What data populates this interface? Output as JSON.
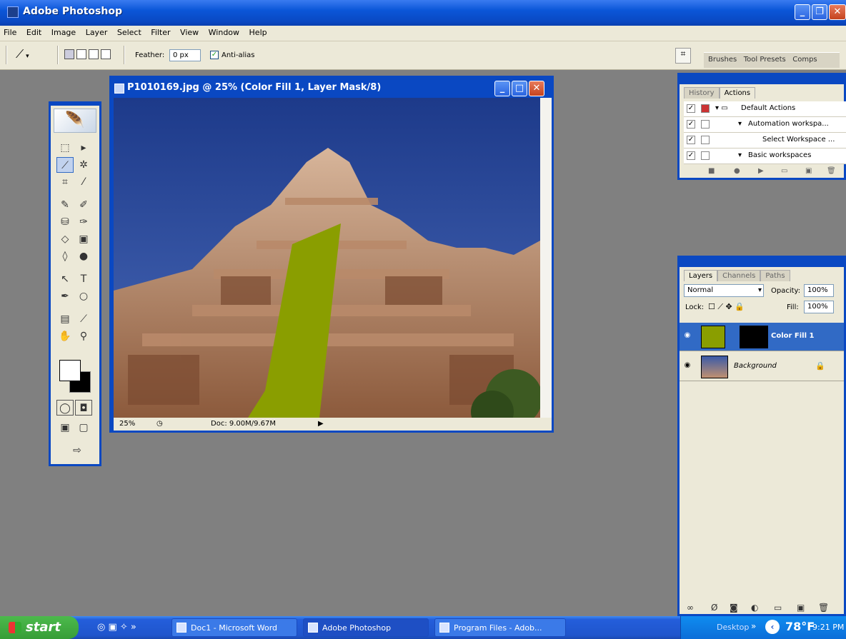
{
  "window": {
    "title": "Adobe Photoshop"
  },
  "menu": [
    "File",
    "Edit",
    "Image",
    "Layer",
    "Select",
    "Filter",
    "View",
    "Window",
    "Help"
  ],
  "options": {
    "feather_label": "Feather:",
    "feather_value": "0 px",
    "antialias_label": "Anti-alias",
    "palette_tabs": [
      "Brushes",
      "Tool Presets",
      "Comps"
    ]
  },
  "document": {
    "title": "P1010169.jpg @ 25% (Color Fill 1, Layer Mask/8)",
    "zoom": "25%",
    "doc_size": "Doc: 9.00M/9.67M",
    "fill_color": "#8a9e00"
  },
  "actions_palette": {
    "tabs": [
      "History",
      "Actions"
    ],
    "rows": [
      "Default Actions",
      "Automation workspa...",
      "Select Workspace ...",
      "Basic workspaces"
    ]
  },
  "layers_palette": {
    "tabs": [
      "Layers",
      "Channels",
      "Paths"
    ],
    "blend_mode": "Normal",
    "opacity_label": "Opacity:",
    "opacity": "100%",
    "lock_label": "Lock:",
    "fill_label": "Fill:",
    "fill": "100%",
    "layers": [
      "Color Fill 1",
      "Background"
    ]
  },
  "taskbar": {
    "start": "start",
    "tasks": [
      "Doc1 - Microsoft Word",
      "Adobe Photoshop",
      "Program Files - Adob..."
    ],
    "desktop_label": "Desktop",
    "temperature": "78°F",
    "time": "9:21 PM"
  }
}
